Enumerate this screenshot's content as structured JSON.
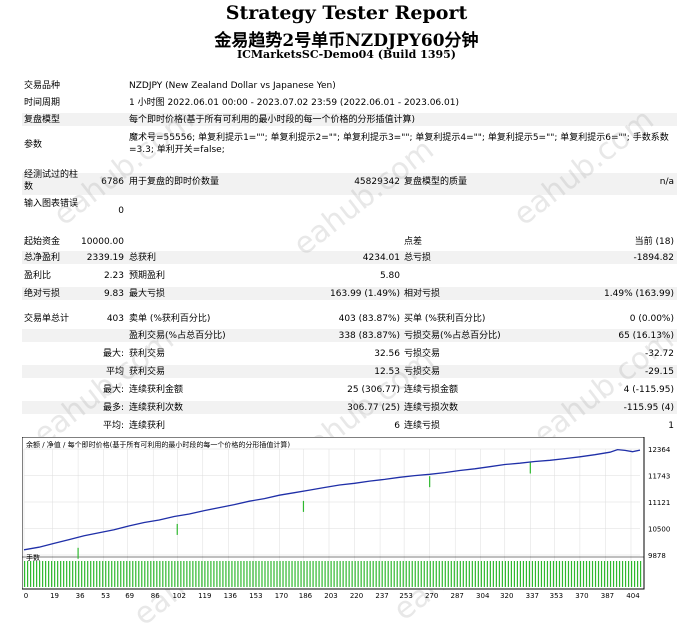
{
  "header": {
    "title": "Strategy Tester Report",
    "subtitle": "金易趋势2号单币NZDJPY60分钟",
    "server": "ICMarketsSC-Demo04 (Build 1395)"
  },
  "settings": {
    "symbol_label": "交易品种",
    "symbol_value": "NZDJPY (New Zealand Dollar vs Japanese Yen)",
    "period_label": "时间周期",
    "period_value": "1 小时图 2022.06.01 00:00 - 2023.07.02 23:59 (2022.06.01 - 2023.06.01)",
    "model_label": "复盘模型",
    "model_value": "每个即时价格(基于所有可利用的最小时段的每一个价格的分形插值计算)",
    "params_label": "参数",
    "params_value": "魔术号=55556; 单复利提示1=\"\"; 单复利提示2=\"\"; 单复利提示3=\"\"; 单复利提示4=\"\"; 单复利提示5=\"\"; 单复利提示6=\"\"; 手数系数=3.3; 单利开关=false;",
    "bars_label": "经测试过的柱数",
    "bars_value": "6786",
    "ticks_label": "用于复盘的即时价数量",
    "ticks_value": "45829342",
    "quality_label": "复盘模型的质量",
    "quality_value": "n/a",
    "errors_label": "输入图表错误",
    "errors_value": "0"
  },
  "results": {
    "deposit_label": "起始资金",
    "deposit_value": "10000.00",
    "spread_label": "点差",
    "spread_value": "当前 (18)",
    "net_label": "总净盈利",
    "net_value": "2339.19",
    "gross_profit_label": "总获利",
    "gross_profit_value": "4234.01",
    "gross_loss_label": "总亏损",
    "gross_loss_value": "-1894.82",
    "pf_label": "盈利比",
    "pf_value": "2.23",
    "payoff_label": "预期盈利",
    "payoff_value": "5.80",
    "abs_dd_label": "绝对亏损",
    "abs_dd_value": "9.83",
    "max_dd_label": "最大亏损",
    "max_dd_value": "163.99 (1.49%)",
    "rel_dd_label": "相对亏损",
    "rel_dd_value": "1.49% (163.99)",
    "total_trades_label": "交易单总计",
    "total_trades_value": "403",
    "short_label": "卖单 (%获利百分比)",
    "short_value": "403 (83.87%)",
    "long_label": "买单 (%获利百分比)",
    "long_value": "0 (0.00%)",
    "profit_trades_label": "盈利交易(%占总百分比)",
    "profit_trades_value": "338 (83.87%)",
    "loss_trades_label": "亏损交易(%占总百分比)",
    "loss_trades_value": "65 (16.13%)",
    "largest_prefix": "最大:",
    "largest_profit_label": "获利交易",
    "largest_profit_value": "32.56",
    "largest_loss_label": "亏损交易",
    "largest_loss_value": "-32.72",
    "average_prefix": "平均",
    "avg_profit_label": "获利交易",
    "avg_profit_value": "12.53",
    "avg_loss_label": "亏损交易",
    "avg_loss_value": "-29.15",
    "max_prefix": "最大:",
    "max_consec_wins_label": "连续获利金额",
    "max_consec_wins_value": "25 (306.77)",
    "max_consec_losses_label": "连续亏损金额",
    "max_consec_losses_value": "4 (-115.95)",
    "maximal_prefix": "最多:",
    "maximal_wins_label": "连续获利次数",
    "maximal_wins_value": "306.77 (25)",
    "maximal_losses_label": "连续亏损次数",
    "maximal_losses_value": "-115.95 (4)",
    "avg_consec_prefix": "平均:",
    "avg_consec_wins_label": "连续获利",
    "avg_consec_wins_value": "6",
    "avg_consec_losses_label": "连续亏损",
    "avg_consec_losses_value": "1"
  },
  "watermark": "eahub.com",
  "chart_data": {
    "type": "line",
    "legend_text": "余额 / 净值 / 每个即时价格(基于所有可利用的最小时段的每一个价格的分形插值计算)",
    "lots_label": "手数",
    "x_ticks": [
      0,
      19,
      36,
      53,
      69,
      86,
      102,
      119,
      136,
      153,
      170,
      186,
      203,
      220,
      237,
      253,
      270,
      287,
      304,
      320,
      337,
      353,
      370,
      387,
      404
    ],
    "y_ticks": [
      9878,
      10500,
      11121,
      11743,
      12364
    ],
    "xlim": [
      0,
      410
    ],
    "ylim": [
      9878,
      12364
    ],
    "series": [
      {
        "name": "余额",
        "color": "#1f2fa8",
        "points": [
          [
            0,
            10000
          ],
          [
            10,
            10060
          ],
          [
            20,
            10150
          ],
          [
            30,
            10240
          ],
          [
            40,
            10330
          ],
          [
            50,
            10400
          ],
          [
            60,
            10470
          ],
          [
            70,
            10560
          ],
          [
            80,
            10640
          ],
          [
            90,
            10700
          ],
          [
            100,
            10780
          ],
          [
            110,
            10840
          ],
          [
            120,
            10920
          ],
          [
            130,
            10990
          ],
          [
            140,
            11060
          ],
          [
            150,
            11140
          ],
          [
            160,
            11200
          ],
          [
            170,
            11280
          ],
          [
            180,
            11340
          ],
          [
            190,
            11400
          ],
          [
            200,
            11460
          ],
          [
            210,
            11520
          ],
          [
            220,
            11560
          ],
          [
            230,
            11610
          ],
          [
            240,
            11650
          ],
          [
            250,
            11700
          ],
          [
            260,
            11740
          ],
          [
            270,
            11770
          ],
          [
            280,
            11810
          ],
          [
            290,
            11860
          ],
          [
            300,
            11900
          ],
          [
            310,
            11950
          ],
          [
            320,
            12000
          ],
          [
            330,
            12030
          ],
          [
            340,
            12070
          ],
          [
            350,
            12100
          ],
          [
            360,
            12140
          ],
          [
            370,
            12180
          ],
          [
            380,
            12230
          ],
          [
            390,
            12290
          ],
          [
            395,
            12350
          ],
          [
            400,
            12330
          ],
          [
            405,
            12300
          ],
          [
            410,
            12339
          ]
        ]
      }
    ],
    "spikes": [
      [
        36,
        10000
      ],
      [
        102,
        10560
      ],
      [
        186,
        11100
      ],
      [
        270,
        11680
      ],
      [
        337,
        12000
      ]
    ],
    "lots_fill": 1
  }
}
